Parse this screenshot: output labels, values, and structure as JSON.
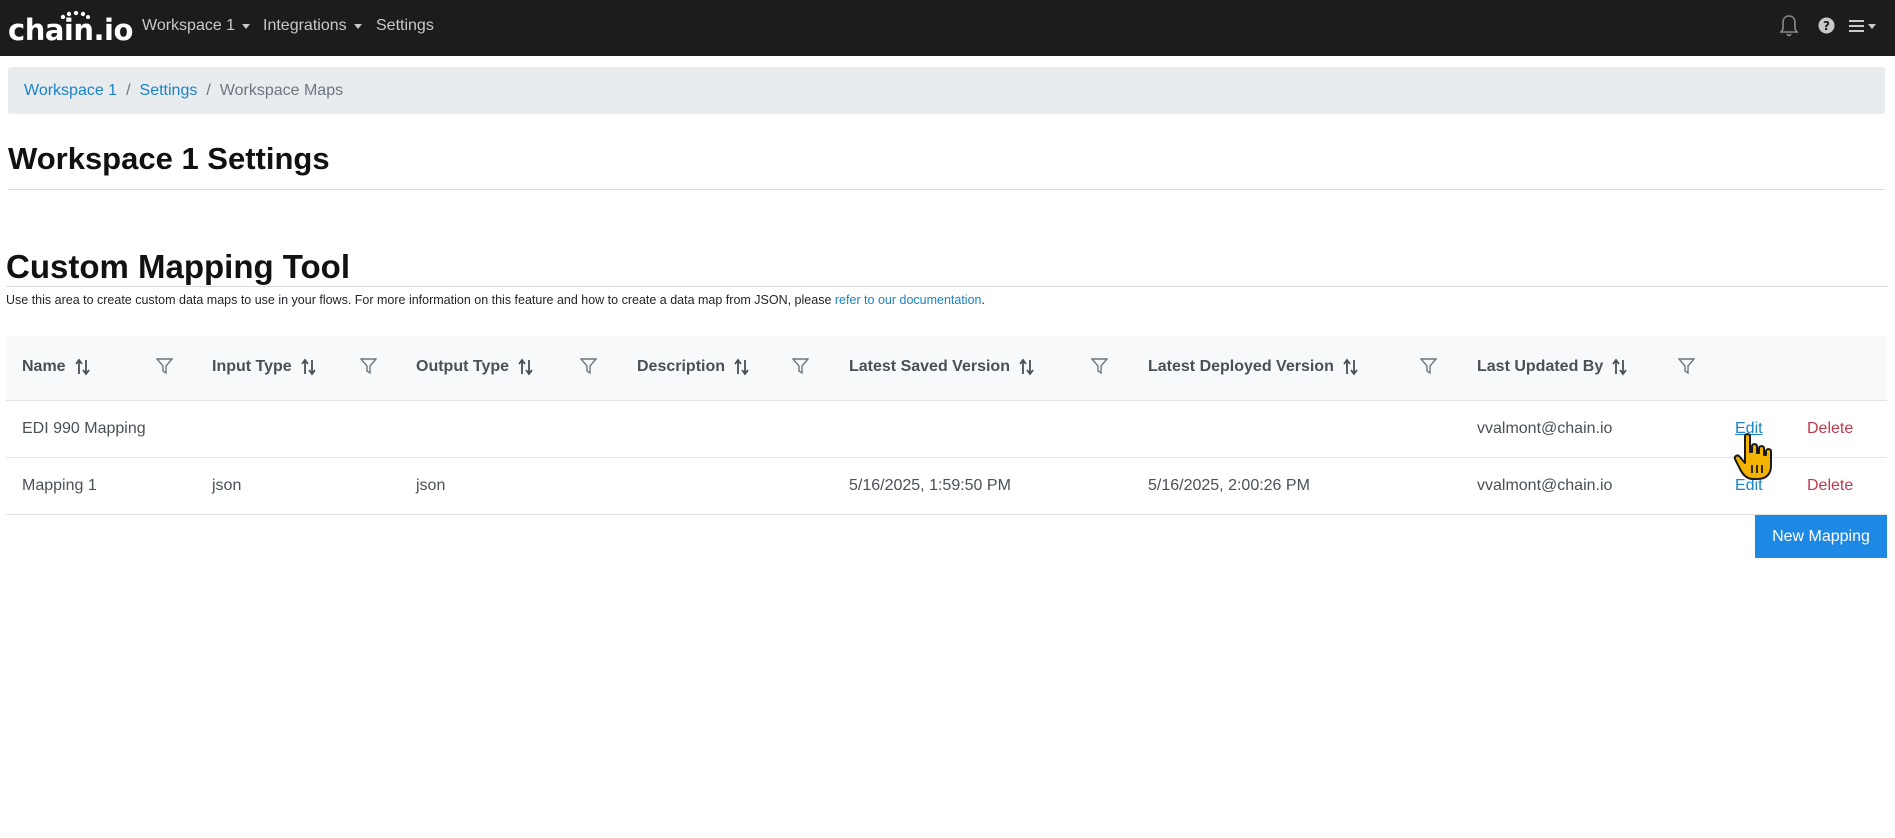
{
  "navbar": {
    "logo": "chain.io",
    "items": [
      {
        "label": "Workspace 1",
        "dropdown": true
      },
      {
        "label": "Integrations",
        "dropdown": true
      },
      {
        "label": "Settings",
        "dropdown": false
      }
    ],
    "icons": [
      "bell-icon",
      "help-icon",
      "hamburger-menu-icon"
    ]
  },
  "breadcrumb": {
    "items": [
      {
        "label": "Workspace 1",
        "link": true
      },
      {
        "label": "Settings",
        "link": true
      },
      {
        "label": "Workspace Maps",
        "link": false
      }
    ],
    "separator": "/"
  },
  "page_title": "Workspace 1 Settings",
  "section": {
    "title": "Custom Mapping Tool",
    "description_prefix": "Use this area to create custom data maps to use in your flows. For more information on this feature and how to create a data map from JSON, please ",
    "description_link": "refer to our documentation",
    "description_suffix": "."
  },
  "table": {
    "columns": [
      "Name",
      "Input Type",
      "Output Type",
      "Description",
      "Latest Saved Version",
      "Latest Deployed Version",
      "Last Updated By"
    ],
    "rows": [
      {
        "name": "EDI 990 Mapping",
        "input_type": "",
        "output_type": "",
        "description": "",
        "latest_saved": "",
        "latest_deployed": "",
        "updated_by": "vvalmont@chain.io",
        "edit": "Edit",
        "delete": "Delete"
      },
      {
        "name": "Mapping 1",
        "input_type": "json",
        "output_type": "json",
        "description": "",
        "latest_saved": "5/16/2025, 1:59:50 PM",
        "latest_deployed": "5/16/2025, 2:00:26 PM",
        "updated_by": "vvalmont@chain.io",
        "edit": "Edit",
        "delete": "Delete"
      }
    ]
  },
  "new_mapping_button": "New Mapping",
  "colors": {
    "navbar_bg": "#1c1c1c",
    "link": "#1a82c4",
    "delete": "#c0394b",
    "primary_button": "#1e88e5",
    "breadcrumb_bg": "#e9ecef"
  }
}
